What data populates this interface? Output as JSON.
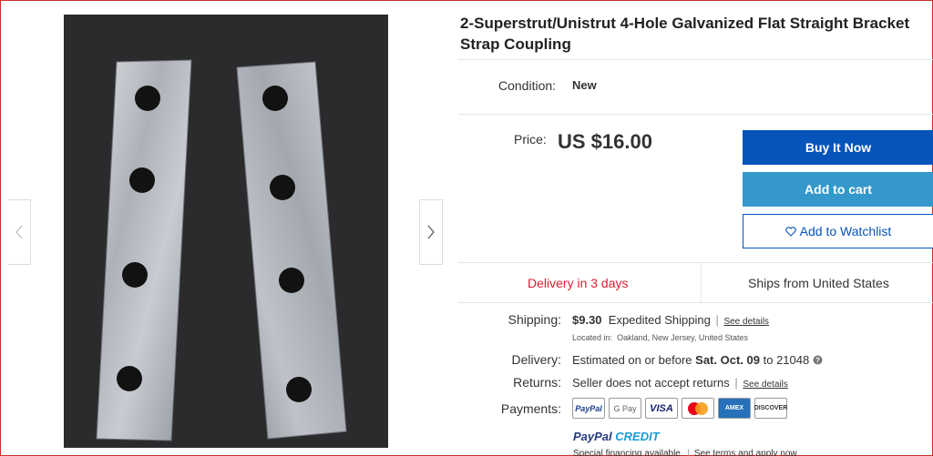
{
  "listing": {
    "title": "2-Superstrut/Unistrut 4-Hole Galvanized Flat Straight Bracket Strap Coupling"
  },
  "condition": {
    "label": "Condition:",
    "value": "New"
  },
  "price": {
    "label": "Price:",
    "value": "US $16.00"
  },
  "buttons": {
    "buy_now": "Buy It Now",
    "add_to_cart": "Add to cart",
    "watchlist": "Add to Watchlist"
  },
  "delivery_box": {
    "fast": "Delivery in 3 days",
    "ships_from": "Ships from United States"
  },
  "shipping": {
    "label": "Shipping:",
    "cost": "$9.30",
    "method": "Expedited Shipping",
    "sep": "|",
    "see_details": "See details",
    "located_prefix": "Located in:",
    "located_value": "Oakland, New Jersey, United States"
  },
  "delivery": {
    "label": "Delivery:",
    "prefix": "Estimated on or before",
    "date": "Sat. Oct. 09",
    "to": "to",
    "zip": "21048"
  },
  "returns": {
    "label": "Returns:",
    "value": "Seller does not accept returns",
    "sep": "|",
    "see_details": "See details"
  },
  "payments": {
    "label": "Payments:",
    "methods": [
      "PayPal",
      "G Pay",
      "VISA",
      "Mastercard",
      "AMEX",
      "DISCOVER"
    ],
    "paypal_credit_1": "PayPal",
    "paypal_credit_2": "CREDIT",
    "financing": "Special financing available.",
    "financing_sep": "|",
    "financing_link": "See terms and apply now"
  },
  "colors": {
    "buy_now": "#0654ba",
    "add_to_cart": "#3498ca",
    "delivery_fast": "#dd1e31",
    "photo_bg": "#2a2a2a"
  }
}
